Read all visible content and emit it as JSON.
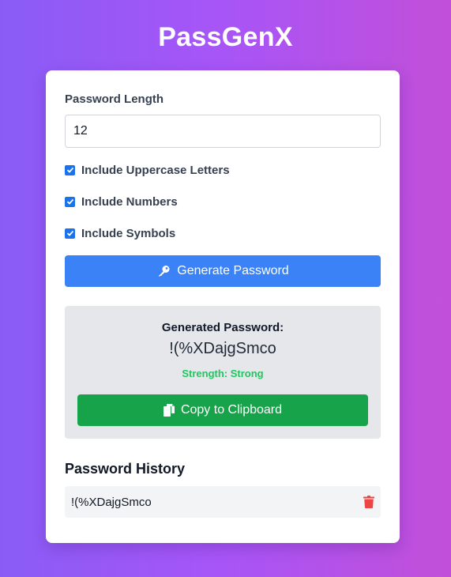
{
  "app": {
    "title": "PassGenX"
  },
  "form": {
    "length_label": "Password Length",
    "length_value": "12",
    "options": [
      {
        "label": "Include Uppercase Letters",
        "checked": true
      },
      {
        "label": "Include Numbers",
        "checked": true
      },
      {
        "label": "Include Symbols",
        "checked": true
      }
    ],
    "generate_label": "Generate Password"
  },
  "result": {
    "heading": "Generated Password:",
    "password": "!(%XDajgSmco",
    "strength": "Strength: Strong",
    "copy_label": "Copy to Clipboard"
  },
  "history": {
    "title": "Password History",
    "items": [
      {
        "value": "!(%XDajgSmco"
      }
    ]
  },
  "colors": {
    "gradient_start": "#8a5cf6",
    "gradient_end": "#c24fd8",
    "primary_button": "#3b82f6",
    "success_button": "#16a34a",
    "strength_text": "#22c55e",
    "delete_icon": "#ef4444"
  },
  "icons": {
    "generate": "key-icon",
    "copy": "clipboard-icon",
    "history_delete": "trash-icon"
  }
}
